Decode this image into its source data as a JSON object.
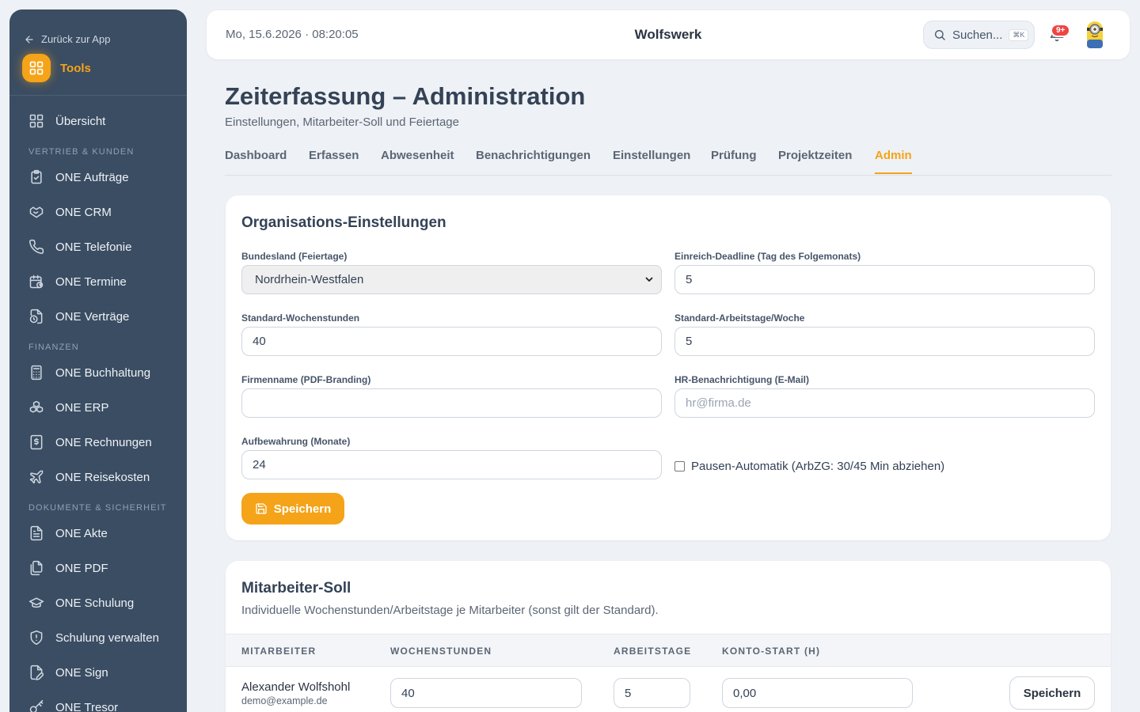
{
  "sidebar": {
    "back_label": "Zurück zur App",
    "tools_label": "Tools",
    "overview_label": "Übersicht",
    "sections": {
      "sales": "VERTRIEB & KUNDEN",
      "finance": "FINANZEN",
      "docs": "DOKUMENTE & SICHERHEIT"
    },
    "items": [
      {
        "label": "ONE Aufträge",
        "icon": "clipboard-check-icon"
      },
      {
        "label": "ONE CRM",
        "icon": "handshake-icon"
      },
      {
        "label": "ONE Telefonie",
        "icon": "phone-icon"
      },
      {
        "label": "ONE Termine",
        "icon": "calendar-clock-icon"
      },
      {
        "label": "ONE Verträge",
        "icon": "file-clock-icon"
      },
      {
        "label": "ONE Buchhaltung",
        "icon": "calculator-icon"
      },
      {
        "label": "ONE ERP",
        "icon": "boxes-icon"
      },
      {
        "label": "ONE Rechnungen",
        "icon": "receipt-icon"
      },
      {
        "label": "ONE Reisekosten",
        "icon": "plane-icon"
      },
      {
        "label": "ONE Akte",
        "icon": "file-text-icon"
      },
      {
        "label": "ONE PDF",
        "icon": "files-icon"
      },
      {
        "label": "ONE Schulung",
        "icon": "graduation-cap-icon"
      },
      {
        "label": "Schulung verwalten",
        "icon": "shield-icon"
      },
      {
        "label": "ONE Sign",
        "icon": "file-signature-icon"
      },
      {
        "label": "ONE Tresor",
        "icon": "key-icon"
      }
    ]
  },
  "header": {
    "datetime": "Mo, 15.6.2026 · 08:20:05",
    "title": "Wolfswerk",
    "search_placeholder": "Suchen...",
    "search_shortcut": "⌘K",
    "notification_count": "9+"
  },
  "page": {
    "title": "Zeiterfassung – Administration",
    "subtitle": "Einstellungen, Mitarbeiter-Soll und Feiertage"
  },
  "tabs": [
    {
      "label": "Dashboard"
    },
    {
      "label": "Erfassen"
    },
    {
      "label": "Abwesenheit"
    },
    {
      "label": "Benachrichtigungen"
    },
    {
      "label": "Einstellungen"
    },
    {
      "label": "Prüfung"
    },
    {
      "label": "Projektzeiten"
    },
    {
      "label": "Admin",
      "active": true
    }
  ],
  "org_settings": {
    "title": "Organisations-Einstellungen",
    "state_label": "Bundesland (Feiertage)",
    "state_value": "Nordrhein-Westfalen",
    "deadline_label": "Einreich-Deadline (Tag des Folgemonats)",
    "deadline_value": "5",
    "weekly_hours_label": "Standard-Wochenstunden",
    "weekly_hours_value": "40",
    "workdays_label": "Standard-Arbeitstage/Woche",
    "workdays_value": "5",
    "company_label": "Firmenname (PDF-Branding)",
    "company_value": "",
    "hr_label": "HR-Benachrichtigung (E-Mail)",
    "hr_placeholder": "hr@firma.de",
    "retention_label": "Aufbewahrung (Monate)",
    "retention_value": "24",
    "pause_label": "Pausen-Automatik (ArbZG: 30/45 Min abziehen)",
    "pause_checked": false,
    "save_label": "Speichern"
  },
  "employee_targets": {
    "title": "Mitarbeiter-Soll",
    "description": "Individuelle Wochenstunden/Arbeitstage je Mitarbeiter (sonst gilt der Standard).",
    "columns": [
      "MITARBEITER",
      "WOCHENSTUNDEN",
      "ARBEITSTAGE",
      "KONTO-START (H)"
    ],
    "rows": [
      {
        "name": "Alexander Wolfshohl",
        "email": "demo@example.de",
        "weekly_hours": "40",
        "workdays": "5",
        "account_start": "0,00",
        "save_label": "Speichern"
      }
    ]
  },
  "colors": {
    "accent": "#f5a318",
    "sidebar_bg": "#3b4d62",
    "page_bg": "#eef1f5",
    "badge": "#ef4444"
  }
}
